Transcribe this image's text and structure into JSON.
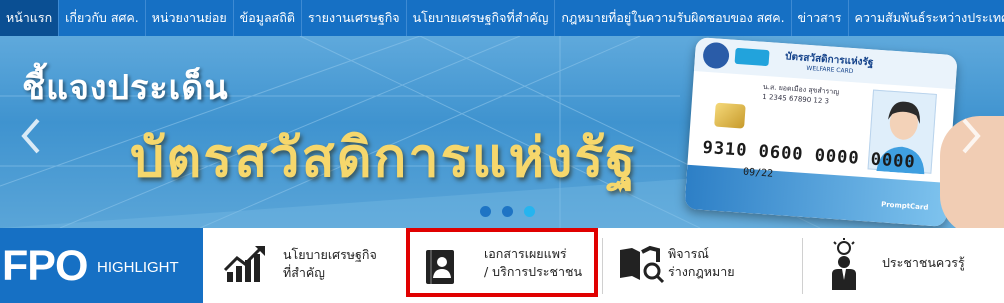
{
  "nav": {
    "items": [
      {
        "label": "หน้าแรก",
        "active": true
      },
      {
        "label": "เกี่ยวกับ สศค."
      },
      {
        "label": "หน่วยงานย่อย"
      },
      {
        "label": "ข้อมูลสถิติ"
      },
      {
        "label": "รายงานเศรษฐกิจ"
      },
      {
        "label": "นโยบายเศรษฐกิจที่สำคัญ"
      },
      {
        "label": "กฎหมายที่อยู่ในความรับผิดชอบของ สศค."
      },
      {
        "label": "ข่าวสาร"
      },
      {
        "label": "ความสัมพันธ์ระหว่างประเทศ"
      }
    ]
  },
  "banner": {
    "subtitle": "ชี้แจงประเด็น",
    "title": "บัตรสวัสดิการแห่งรัฐ",
    "prev_icon": "chevron-left-icon",
    "next_icon": "chevron-right-icon",
    "card": {
      "title_th": "บัตรสวัสดิการแห่งรัฐ",
      "title_en": "WELFARE CARD",
      "holder": "น.ส. ยอดเมือง สุขสำราญ",
      "id_small": "1 2345 67890 12 3",
      "number": "9310 0600 0000 0000",
      "expiry": "09/22",
      "brand": "PromptCard"
    },
    "dots": [
      {
        "active": false
      },
      {
        "active": false
      },
      {
        "active": true
      }
    ]
  },
  "highlight": {
    "brand": "FPO",
    "label": "HIGHLIGHT",
    "items": [
      {
        "icon": "growth-chart-icon",
        "line1": "นโยบายเศรษฐกิจ",
        "line2": "ที่สำคัญ"
      },
      {
        "icon": "document-book-icon",
        "line1": "เอกสารเผยแพร่",
        "line2": "/ บริการประชาชน",
        "selected": true
      },
      {
        "icon": "law-book-search-icon",
        "line1": "พิจารณ์",
        "line2": "ร่างกฎหมาย"
      },
      {
        "icon": "idea-person-icon",
        "line1": "ประชาชนควรรู้",
        "line2": ""
      }
    ]
  },
  "colors": {
    "nav_bg": "#1670c4",
    "nav_active": "#0a4f93",
    "banner_title": "#f6d76c",
    "selected_border": "#e00000"
  }
}
